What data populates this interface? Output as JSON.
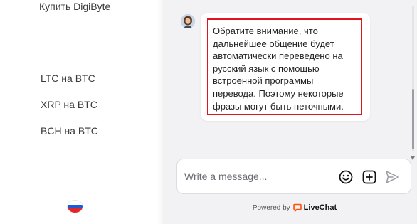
{
  "nav": {
    "links": [
      "Купить DigiByte",
      "LTC на BTC",
      "XRP на BTC",
      "BCH на BTC"
    ]
  },
  "chat": {
    "agent_message": "Обратите внимание, что дальнейшее общение будет автоматически переведено на русский язык с помощью встроенной программы перевода. Поэтому некоторые фразы могут быть неточными.",
    "composer_placeholder": "Write a message...",
    "powered_by": "Powered by",
    "brand": "LiveChat",
    "highlight_color": "#e0141e",
    "brand_color": "#ff5100"
  },
  "icons": [
    "avatar",
    "emoji-icon",
    "add-attachment-icon",
    "send-icon",
    "livechat-logo-icon",
    "russian-flag-icon"
  ]
}
